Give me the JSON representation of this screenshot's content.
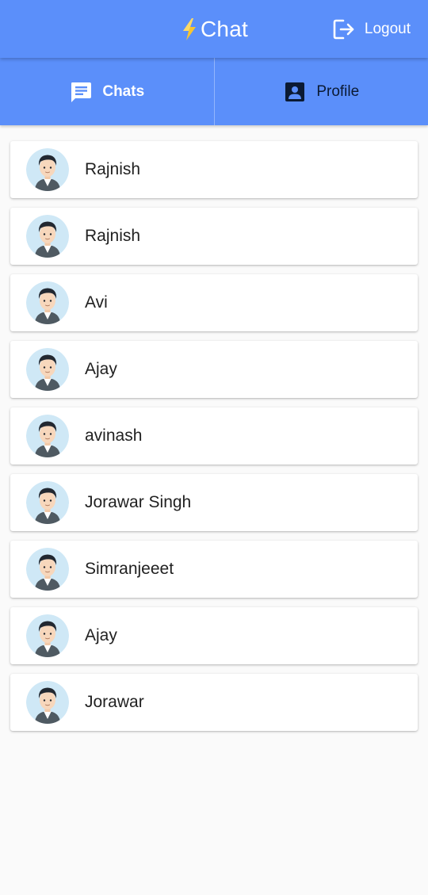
{
  "header": {
    "title": "Chat",
    "logo_icon": "lightning-bolt-icon",
    "logout_label": "Logout",
    "logout_icon": "logout-icon"
  },
  "tabs": [
    {
      "label": "Chats",
      "icon": "chat-bubble-icon",
      "active": true
    },
    {
      "label": "Profile",
      "icon": "contact-card-icon",
      "active": false
    }
  ],
  "contacts": [
    {
      "name": "Rajnish"
    },
    {
      "name": "Rajnish"
    },
    {
      "name": "Avi"
    },
    {
      "name": "Ajay"
    },
    {
      "name": "avinash"
    },
    {
      "name": "Jorawar Singh"
    },
    {
      "name": "Simranjeeet"
    },
    {
      "name": "Ajay"
    },
    {
      "name": "Jorawar"
    }
  ],
  "colors": {
    "primary": "#5b8ffa",
    "background": "#fafafa",
    "card": "#ffffff",
    "inactive_tab_text": "#0b1a33",
    "bolt": "#f7c531"
  }
}
